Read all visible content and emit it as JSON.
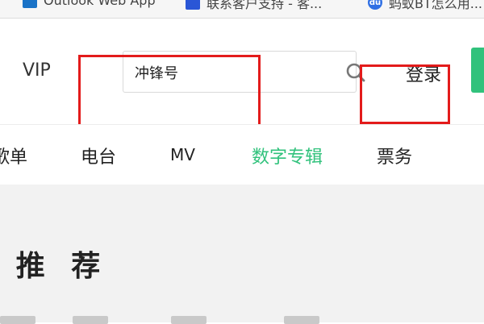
{
  "bookmarks": [
    {
      "label": "Outlook Web App"
    },
    {
      "label": "联系客户支持 - 客..."
    },
    {
      "label": "蚂蚁BT怎么用..."
    }
  ],
  "header": {
    "vip_label": "VIP",
    "search_value": "冲锋号",
    "login_label": "登录"
  },
  "nav": {
    "items": [
      "歌单",
      "电台",
      "MV",
      "数字专辑",
      "票务"
    ],
    "active": "数字专辑"
  },
  "content": {
    "section_title": "推 荐"
  },
  "colors": {
    "accent": "#31c27c",
    "annotation": "#e31b1b"
  }
}
